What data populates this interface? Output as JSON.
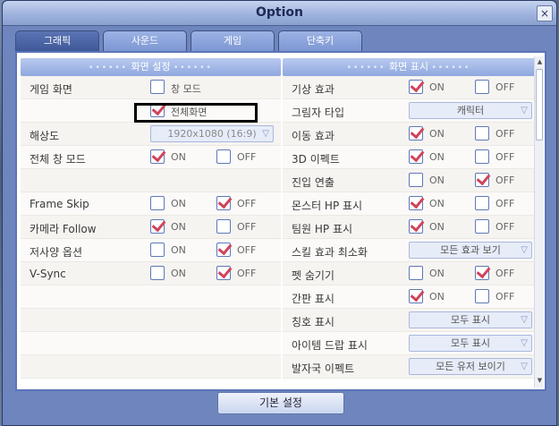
{
  "window": {
    "title": "Option"
  },
  "tabs": [
    "그래픽",
    "사운드",
    "게임",
    "단축키"
  ],
  "left": {
    "header": "화면 설정",
    "rows": [
      {
        "label": "게임 화면",
        "opt": {
          "checked": false,
          "text": "창 모드"
        }
      },
      {
        "label": "",
        "opt": {
          "checked": true,
          "text": "전체화면"
        }
      },
      {
        "label": "해상도",
        "select": "1920x1080 (16:9)"
      },
      {
        "label": "전체 창 모드",
        "on": true,
        "off": false
      },
      {
        "label": "",
        "empty": true
      },
      {
        "label": "Frame Skip",
        "on": false,
        "off": true
      },
      {
        "label": "카메라 Follow",
        "on": true,
        "off": false
      },
      {
        "label": "저사양 옵션",
        "on": false,
        "off": true
      },
      {
        "label": "V-Sync",
        "on": false,
        "off": true
      }
    ]
  },
  "right": {
    "header": "화면 표시",
    "rows": [
      {
        "label": "기상 효과",
        "on": true,
        "off": false
      },
      {
        "label": "그림자 타입",
        "select": "캐릭터"
      },
      {
        "label": "이동 효과",
        "on": true,
        "off": false
      },
      {
        "label": "3D 이펙트",
        "on": true,
        "off": false
      },
      {
        "label": "진입 연출",
        "on": false,
        "off": true
      },
      {
        "label": "몬스터 HP 표시",
        "on": true,
        "off": false
      },
      {
        "label": "팀원 HP 표시",
        "on": true,
        "off": false
      },
      {
        "label": "스킬 효과 최소화",
        "select": "모든 효과 보기"
      },
      {
        "label": "펫 숨기기",
        "on": false,
        "off": true
      },
      {
        "label": "간판 표시",
        "on": true,
        "off": false
      },
      {
        "label": "칭호 표시",
        "select": "모두 표시"
      },
      {
        "label": "아이템 드랍 표시",
        "select": "모두 표시"
      },
      {
        "label": "발자국 이펙트",
        "select": "모든 유저 보이기"
      }
    ]
  },
  "labels": {
    "on": "ON",
    "off": "OFF"
  },
  "footer": {
    "button": "기본 설정"
  }
}
